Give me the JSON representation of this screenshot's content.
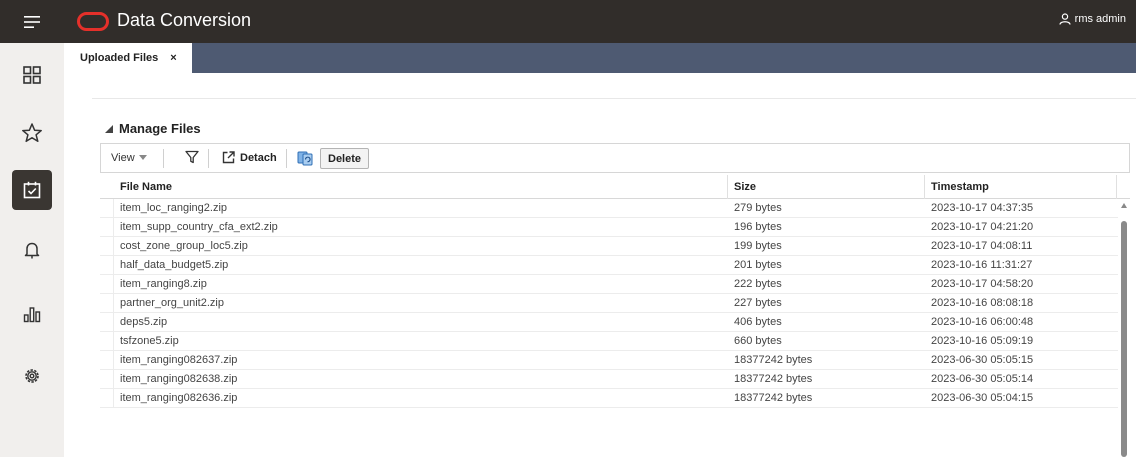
{
  "header": {
    "app_title": "Data Conversion",
    "user_label": "rms admin"
  },
  "sidebar": {
    "items": [
      {
        "icon": "grid-icon",
        "active": false
      },
      {
        "icon": "star-icon",
        "active": false
      },
      {
        "icon": "task-calendar-icon",
        "active": true
      },
      {
        "icon": "bell-icon",
        "active": false
      },
      {
        "icon": "bar-chart-icon",
        "active": false
      },
      {
        "icon": "gear-icon",
        "active": false
      }
    ]
  },
  "tabs": [
    {
      "label": "Uploaded Files",
      "close_label": "×"
    }
  ],
  "section": {
    "title": "Manage Files"
  },
  "toolbar": {
    "view_label": "View",
    "detach_label": "Detach",
    "delete_label": "Delete"
  },
  "table": {
    "columns": [
      "File Name",
      "Size",
      "Timestamp"
    ],
    "rows": [
      [
        "item_loc_ranging2.zip",
        "279 bytes",
        "2023-10-17 04:37:35"
      ],
      [
        "item_supp_country_cfa_ext2.zip",
        "196 bytes",
        "2023-10-17 04:21:20"
      ],
      [
        "cost_zone_group_loc5.zip",
        "199 bytes",
        "2023-10-17 04:08:11"
      ],
      [
        "half_data_budget5.zip",
        "201 bytes",
        "2023-10-16 11:31:27"
      ],
      [
        "item_ranging8.zip",
        "222 bytes",
        "2023-10-17 04:58:20"
      ],
      [
        "partner_org_unit2.zip",
        "227 bytes",
        "2023-10-16 08:08:18"
      ],
      [
        "deps5.zip",
        "406 bytes",
        "2023-10-16 06:00:48"
      ],
      [
        "tsfzone5.zip",
        "660 bytes",
        "2023-10-16 05:09:19"
      ],
      [
        "item_ranging082637.zip",
        "18377242 bytes",
        "2023-06-30 05:05:15"
      ],
      [
        "item_ranging082638.zip",
        "18377242 bytes",
        "2023-06-30 05:05:14"
      ],
      [
        "item_ranging082636.zip",
        "18377242 bytes",
        "2023-06-30 05:04:15"
      ]
    ]
  },
  "colors": {
    "topbar": "#312d2a",
    "brand_red": "#e5302a",
    "tabstrip": "#4e5a72",
    "sidebar": "#f1efed",
    "active_nav": "#3a3632"
  }
}
